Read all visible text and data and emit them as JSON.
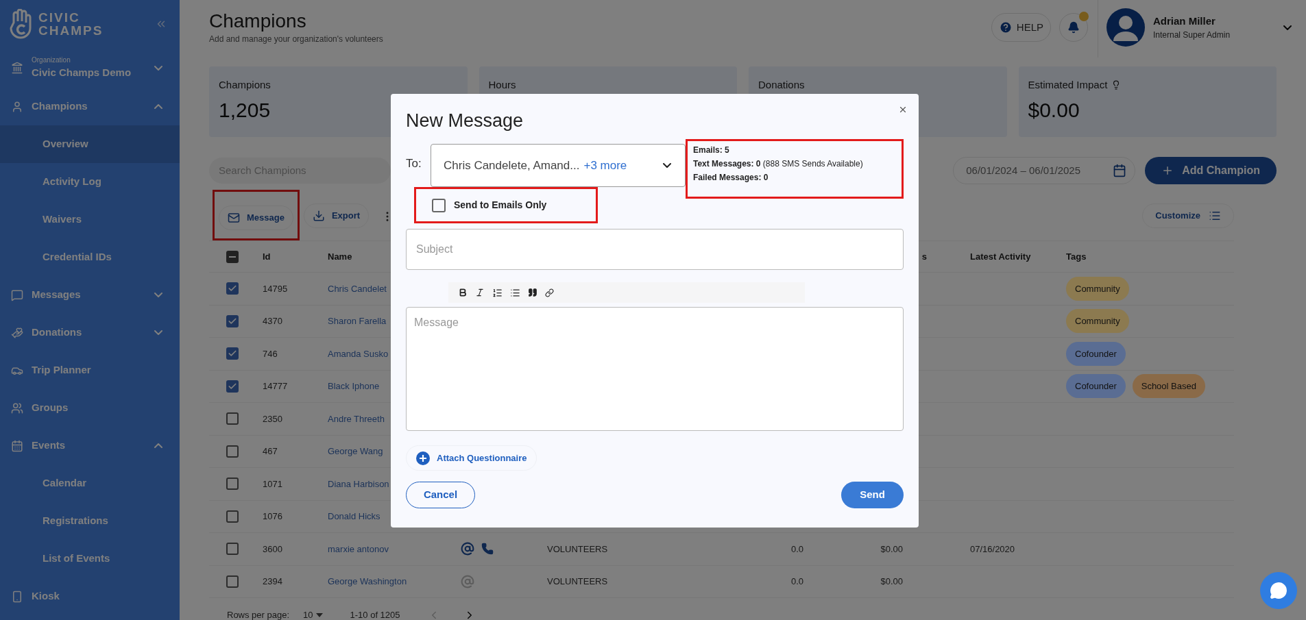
{
  "sidebar": {
    "brand": [
      "CIVIC",
      "CHAMPS"
    ],
    "organization": {
      "label": "Organization",
      "name": "Civic Champs Demo",
      "expanded": false
    },
    "items": [
      {
        "label": "Champions",
        "expanded": true,
        "children": [
          {
            "label": "Overview",
            "selected": true
          },
          {
            "label": "Activity Log",
            "selected": false
          },
          {
            "label": "Waivers",
            "selected": false
          },
          {
            "label": "Credential IDs",
            "selected": false
          }
        ]
      },
      {
        "label": "Messages",
        "expanded": false
      },
      {
        "label": "Donations",
        "expanded": false
      },
      {
        "label": "Trip Planner"
      },
      {
        "label": "Groups"
      },
      {
        "label": "Events",
        "expanded": true,
        "children": [
          {
            "label": "Calendar",
            "selected": false
          },
          {
            "label": "Registrations",
            "selected": false
          },
          {
            "label": "List of Events",
            "selected": false
          }
        ]
      },
      {
        "label": "Kiosk"
      }
    ]
  },
  "header": {
    "title": "Champions",
    "subtitle": "Add and manage your organization's volunteers",
    "help": "HELP",
    "notification": true,
    "user": {
      "name": "Adrian Miller",
      "role": "Internal Super Admin"
    }
  },
  "stats": [
    {
      "label": "Champions",
      "value": "1,205"
    },
    {
      "label": "Hours"
    },
    {
      "label": "Donations"
    },
    {
      "label": "Estimated Impact",
      "value": "$0.00",
      "info": true
    }
  ],
  "search": {
    "placeholder": "Search Champions"
  },
  "date_range": "06/01/2024 – 06/01/2025",
  "add_button": "Add Champion",
  "toolbar": [
    {
      "label": "Message",
      "highlighted": true
    },
    {
      "label": "Export",
      "highlighted": false
    }
  ],
  "customize": "Customize",
  "table": {
    "header_checkbox": {
      "indeterminate": true
    },
    "columns": [
      "Id",
      "Name",
      "s",
      "Latest Activity",
      "Tags"
    ],
    "rows": [
      {
        "checked": true,
        "id": "14795",
        "name": "Chris Candelet",
        "tags": [
          {
            "label": "Community",
            "color": "#8c7a50"
          }
        ]
      },
      {
        "checked": true,
        "id": "4370",
        "name": "Sharon Farella",
        "tags": [
          {
            "label": "Community",
            "color": "#8c7a50"
          }
        ]
      },
      {
        "checked": true,
        "id": "746",
        "name": "Amanda Susko",
        "tags": [
          {
            "label": "Cofounder",
            "color": "#5a6d93"
          }
        ]
      },
      {
        "checked": true,
        "id": "14777",
        "name": "Black Iphone",
        "tags": [
          {
            "label": "Cofounder",
            "color": "#5a6d93"
          },
          {
            "label": "School Based",
            "color": "#8a6a48"
          }
        ]
      },
      {
        "checked": false,
        "id": "2350",
        "name": "Andre Threeth"
      },
      {
        "checked": false,
        "id": "467",
        "name": "George Wang"
      },
      {
        "checked": false,
        "id": "1071",
        "name": "Diana Harbison"
      },
      {
        "checked": false,
        "id": "1076",
        "name": "Donald Hicks"
      },
      {
        "checked": false,
        "id": "3600",
        "name": "marxie antonov",
        "contact": {
          "email_active": true,
          "phone": true
        },
        "group": "VOLUNTEERS",
        "hours": "0.0",
        "donations": "$0.00",
        "latest": "07/16/2020"
      },
      {
        "checked": false,
        "id": "2394",
        "name": "George Washington",
        "contact": {
          "email_active": false,
          "phone": false
        },
        "group": "VOLUNTEERS",
        "hours": "0.0",
        "donations": "$0.00"
      }
    ],
    "footer": {
      "rows_label": "Rows per page:",
      "rows_value": "10",
      "range": "1-10 of 1205"
    }
  },
  "modal": {
    "title": "New Message",
    "to_label": "To:",
    "recipients": "Chris Candelete, Amand...",
    "more": "+3 more",
    "emails_only": {
      "label": "Send to Emails Only",
      "checked": false,
      "highlighted": true
    },
    "stats_highlighted": true,
    "stats": [
      {
        "text": "Emails: 5"
      },
      {
        "text": "Text Messages: 0",
        "note": "(888 SMS Sends Available)"
      },
      {
        "text": "Failed Messages: 0"
      }
    ],
    "subject_placeholder": "Subject",
    "message_placeholder": "Message",
    "attach": "Attach Questionnaire",
    "cancel": "Cancel",
    "send": "Send"
  }
}
